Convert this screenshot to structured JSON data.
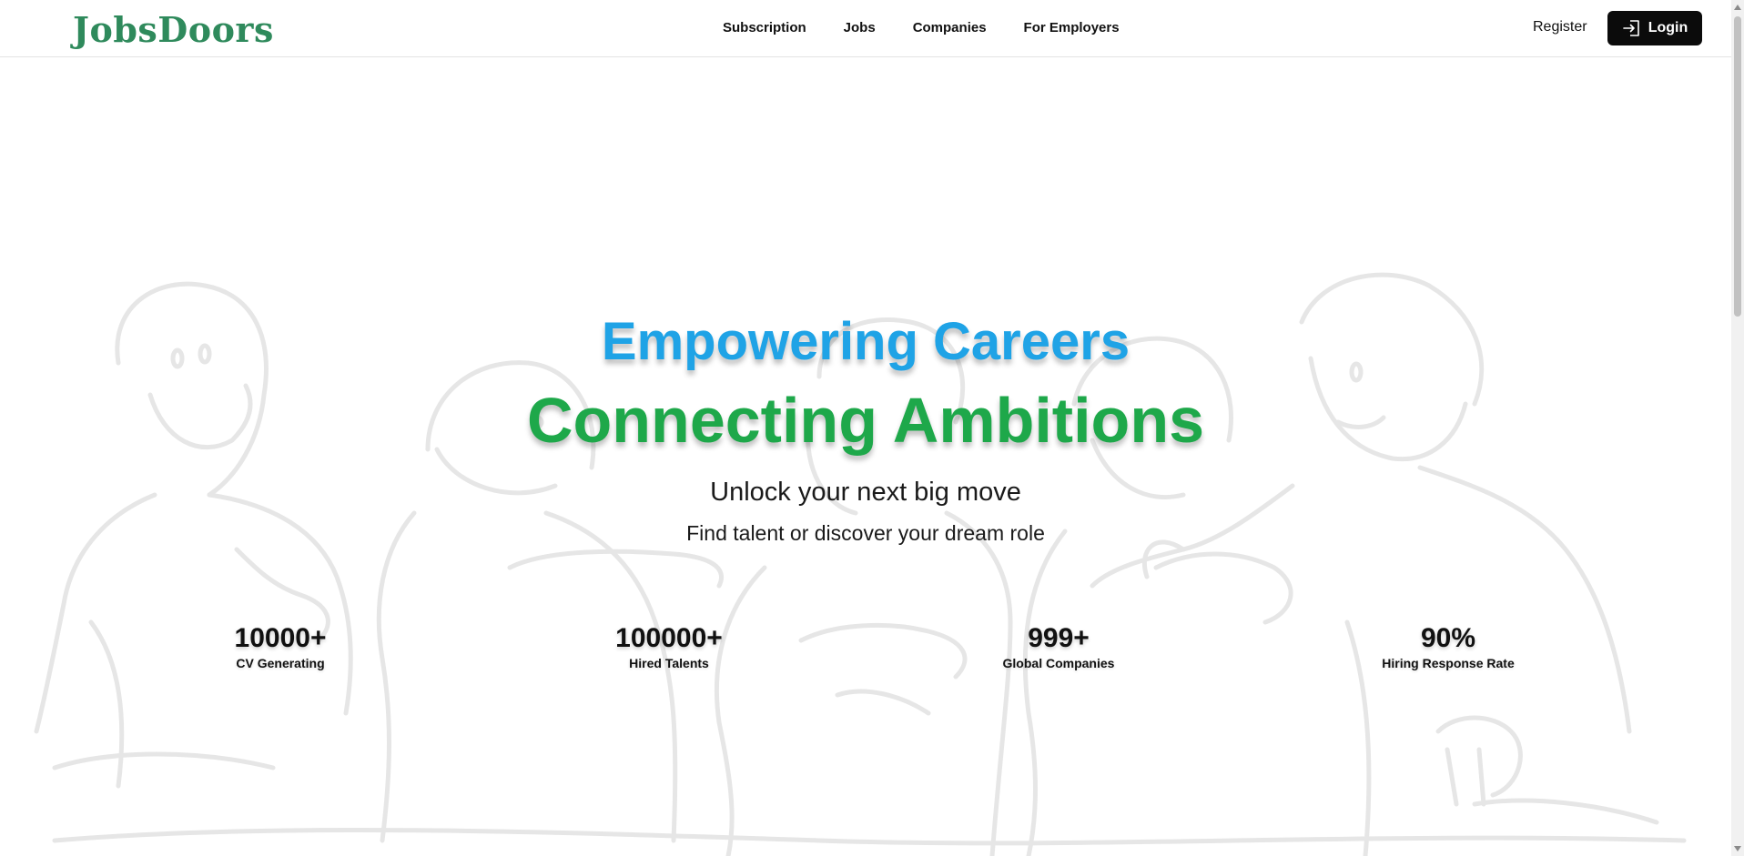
{
  "brand": {
    "logo_text": "JobsDoors",
    "logo_color": "#2f8a5c"
  },
  "nav": {
    "links": [
      {
        "label": "Subscription"
      },
      {
        "label": "Jobs"
      },
      {
        "label": "Companies"
      },
      {
        "label": "For Employers"
      }
    ],
    "register_label": "Register",
    "login_label": "Login",
    "login_icon": "login-icon"
  },
  "hero": {
    "headline_1": "Empowering Careers",
    "headline_2": "Connecting Ambitions",
    "subheadline_1": "Unlock your next big move",
    "subheadline_2": "Find talent or discover your dream role",
    "colors": {
      "headline_1": "#1fa3e6",
      "headline_2": "#1ea84a"
    }
  },
  "stats": [
    {
      "value": "10000+",
      "label": "CV Generating"
    },
    {
      "value": "100000+",
      "label": "Hired Talents"
    },
    {
      "value": "999+",
      "label": "Global Companies"
    },
    {
      "value": "90%",
      "label": "Hiring Response Rate"
    }
  ]
}
